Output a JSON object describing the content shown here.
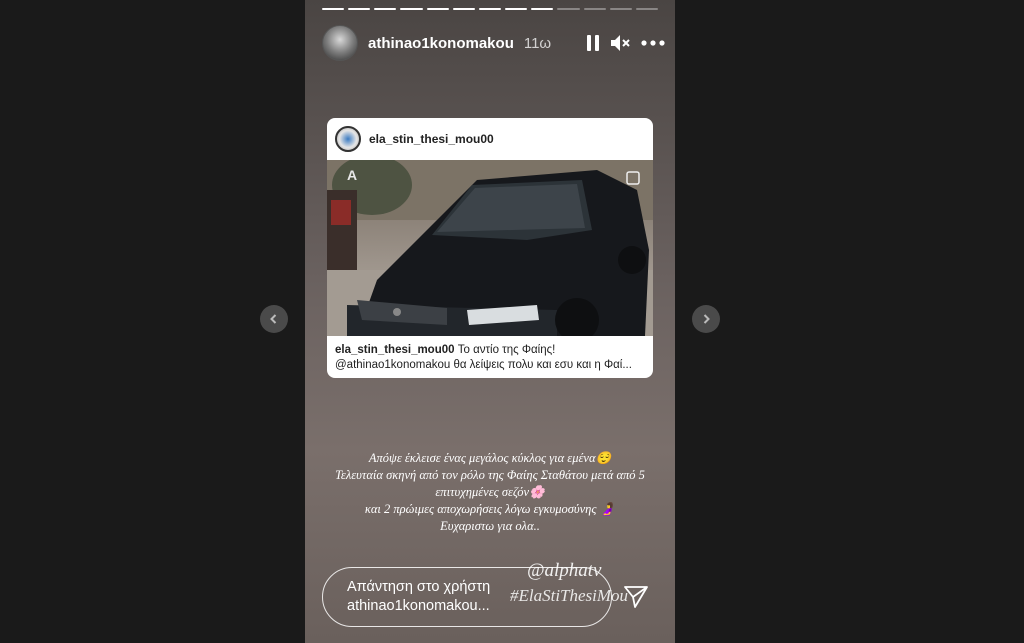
{
  "story": {
    "progress_total": 13,
    "progress_done": 9
  },
  "header": {
    "username": "athinao1konomakou",
    "time": "11ω"
  },
  "icons": {
    "pause": "pause-icon",
    "mute": "volume-mute-icon",
    "more": "more-icon",
    "send": "send-icon",
    "prev": "chevron-left-icon",
    "next": "chevron-right-icon"
  },
  "shared_post": {
    "username": "ela_stin_thesi_mou00",
    "caption_user": "ela_stin_thesi_mou00",
    "caption_text": "Το αντίο της Φαίης!",
    "caption_line2": "@athinao1konomakou θα λείψεις πολυ και εσυ και η Φαί..."
  },
  "story_text": {
    "line1": "Απόψε έκλεισε ένας μεγάλος κύκλος για εμένα😌",
    "line2": "Τελευταία σκηνή από τον ρόλο της Φαίης Σταθάτου μετά από 5",
    "line3": "επιτυχημένες σεζόν🌸",
    "line4": "και 2 πρώιμες αποχωρήσεις λόγω εγκυμοσύνης 🤰",
    "line5": "Ευχαριστω για ολα.."
  },
  "tags": {
    "mention": "@alphatv",
    "hashtag": "#ElaStiThesiMou"
  },
  "reply": {
    "placeholder_line1": "Απάντηση στο χρήστη",
    "placeholder_line2": "athinao1konomakou..."
  }
}
